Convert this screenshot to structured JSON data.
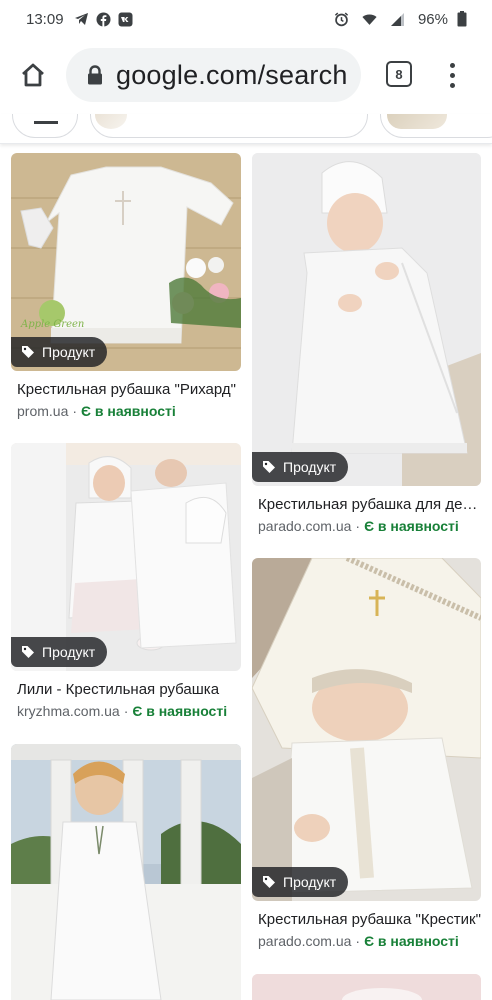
{
  "status_bar": {
    "time": "13:09",
    "battery": "96%",
    "icons": [
      "telegram-icon",
      "facebook-icon",
      "vk-icon",
      "alarm-icon",
      "wifi-icon",
      "signal-icon",
      "battery-icon"
    ]
  },
  "browser": {
    "url": "google.com/search",
    "tab_count": "8",
    "icons": [
      "home-icon",
      "lock-icon",
      "tabs-icon",
      "more-vert-icon"
    ]
  },
  "colors": {
    "availability": "#188038",
    "badge_bg": "#202124",
    "url_bar_bg": "#f1f3f4"
  },
  "results": [
    {
      "badge": "Продукт",
      "title": "Крестильная рубашка \"Рихард\"",
      "site": "prom.ua",
      "availability": "Є в наявності"
    },
    {
      "badge": "Продукт",
      "title": "Крестильная рубашка для девочки",
      "site": "parado.com.ua",
      "availability": "Є в наявності"
    },
    {
      "badge": "Продукт",
      "title": "Лили - Крестильная рубашка",
      "site": "kryzhma.com.ua",
      "availability": "Є в наявності"
    },
    {
      "badge": "Продукт",
      "title": "Крестильная рубашка \"Крестик\"",
      "site": "parado.com.ua",
      "availability": "Є в наявності"
    },
    {
      "badge": "",
      "title": "",
      "site": "",
      "availability": ""
    }
  ],
  "image_labels": {
    "logo_text": "Apple Green"
  }
}
